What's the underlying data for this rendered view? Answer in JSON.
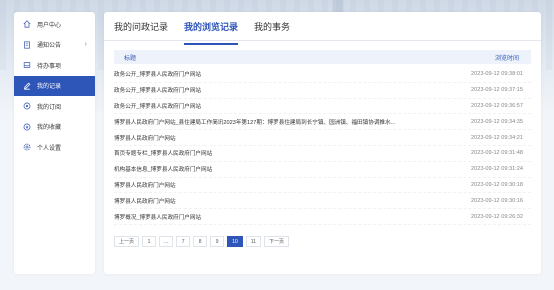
{
  "sidebar": {
    "items": [
      {
        "label": "用户中心",
        "icon": "home-icon",
        "active": false
      },
      {
        "label": "通知公告",
        "icon": "document-icon",
        "active": false,
        "has_arrow": true
      },
      {
        "label": "待办事项",
        "icon": "inbox-icon",
        "active": false
      },
      {
        "label": "我的记录",
        "icon": "pen-icon",
        "active": true
      },
      {
        "label": "我的订阅",
        "icon": "bell-icon",
        "active": false
      },
      {
        "label": "我的收藏",
        "icon": "star-icon",
        "active": false
      },
      {
        "label": "个人设置",
        "icon": "gear-icon",
        "active": false
      }
    ],
    "arrow": "›"
  },
  "tabs": [
    {
      "label": "我的问政记录",
      "active": false
    },
    {
      "label": "我的浏览记录",
      "active": true
    },
    {
      "label": "我的事务",
      "active": false
    }
  ],
  "table": {
    "headers": {
      "title": "标题",
      "time": "浏览时间"
    },
    "rows": [
      {
        "title": "政务公开_博罗县人民政府门户网站",
        "time": "2023-09-12 09:38:01"
      },
      {
        "title": "政务公开_博罗县人民政府门户网站",
        "time": "2023-09-12 09:37:15"
      },
      {
        "title": "政务公开_博罗县人民政府门户网站",
        "time": "2023-09-12 09:36:57"
      },
      {
        "title": "博罗县人民政府门户网站_县住建局工作简讯2023年第127期：博罗县住建局到长宁镇、园洲镇、福田镇协调推水...",
        "time": "2023-09-12 09:34:35"
      },
      {
        "title": "博罗县人民政府门户网站",
        "time": "2023-09-12 09:34:21"
      },
      {
        "title": "首页专题专栏_博罗县人民政府门户网站",
        "time": "2023-09-12 09:31:48"
      },
      {
        "title": "机构基本信息_博罗县人民政府门户网站",
        "time": "2023-09-12 09:31:24"
      },
      {
        "title": "博罗县人民政府门户网站",
        "time": "2023-09-12 09:30:18"
      },
      {
        "title": "博罗县人民政府门户网站",
        "time": "2023-09-12 09:30:16"
      },
      {
        "title": "博罗概况_博罗县人民政府门户网站",
        "time": "2023-09-12 09:26:32"
      }
    ]
  },
  "pagination": {
    "prev": "上一页",
    "pages": [
      "1",
      "...",
      "7",
      "8",
      "9",
      "10",
      "11"
    ],
    "current": "10",
    "next": "下一页"
  },
  "colors": {
    "accent": "#2e55b8",
    "header_bg": "#eef3fb"
  }
}
